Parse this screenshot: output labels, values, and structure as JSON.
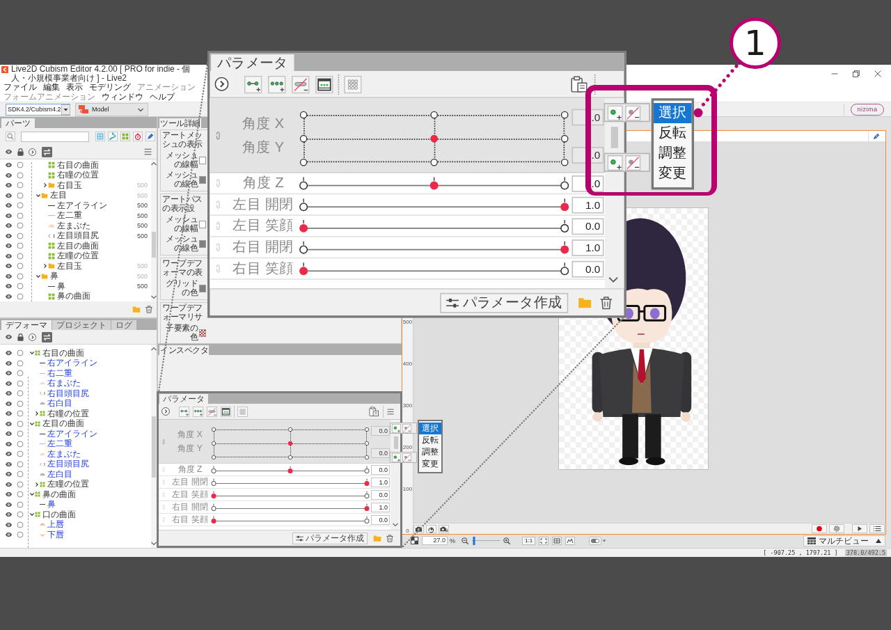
{
  "window": {
    "title": "Live2D Cubism Editor 4.2.00 [ PRO for indie - 個人・小規模事業者向け ] - Live2"
  },
  "menu": [
    {
      "label": "ファイル",
      "disabled": false
    },
    {
      "label": "編集",
      "disabled": false
    },
    {
      "label": "表示",
      "disabled": false
    },
    {
      "label": "モデリング",
      "disabled": false
    },
    {
      "label": "アニメーション",
      "disabled": true
    },
    {
      "label": "フォームアニメーション",
      "disabled": true
    },
    {
      "label": "ウィンドウ",
      "disabled": false
    },
    {
      "label": "ヘルプ",
      "disabled": false
    }
  ],
  "toolbar": {
    "sdk_select": "SDK4.2/Cubism4.2",
    "mode_dropdown": "Model",
    "logo": "nizima"
  },
  "parts_panel": {
    "tab": "パーツ",
    "tree": [
      {
        "children": [
          {
            "label": "右目の曲面",
            "kind": "warp"
          },
          {
            "label": "右瞳の位置",
            "kind": "warp"
          },
          {
            "label": "右目玉",
            "kind": "folder",
            "expanded": false,
            "value": "500"
          }
        ]
      },
      {
        "label": "左目",
        "kind": "folder",
        "expanded": true,
        "value": "500",
        "children": [
          {
            "label": "左アイライン",
            "kind": "line",
            "color": "#3d2f4f",
            "value": "500"
          },
          {
            "label": "左二重",
            "kind": "line",
            "color": "#e6a9a9",
            "value": "500"
          },
          {
            "label": "左まぶた",
            "kind": "lid",
            "color": "#fbd9c4",
            "value": "500"
          },
          {
            "label": "左目頭目尻",
            "kind": "corner",
            "value": "500"
          },
          {
            "label": "左目の曲面",
            "kind": "warp"
          },
          {
            "label": "左瞳の位置",
            "kind": "warp"
          },
          {
            "label": "左目玉",
            "kind": "folder",
            "expanded": false,
            "value": "500"
          }
        ]
      },
      {
        "label": "鼻",
        "kind": "folder",
        "expanded": true,
        "value": "500",
        "children": [
          {
            "label": "鼻",
            "kind": "line",
            "color": "#4a4a4a",
            "value": "500"
          },
          {
            "label": "鼻の曲面",
            "kind": "warp"
          }
        ]
      }
    ]
  },
  "deformer_panel": {
    "tabs": [
      {
        "label": "デフォーマ",
        "selected": true
      },
      {
        "label": "プロジェクト",
        "selected": false
      },
      {
        "label": "ログ",
        "selected": false
      }
    ],
    "tree": [
      {
        "label": "右目の曲面",
        "kind": "warp",
        "expanded": true,
        "children": [
          {
            "label": "右アイライン",
            "kind": "line",
            "color": "#3d2f4f"
          },
          {
            "label": "右二重",
            "kind": "line",
            "color": "#e6a9a9"
          },
          {
            "label": "右まぶた",
            "kind": "lid",
            "color": "#fbd9c4"
          },
          {
            "label": "右目頭目尻",
            "kind": "corner"
          },
          {
            "label": "右白目",
            "kind": "lid",
            "color": "#b5b5b5"
          },
          {
            "label": "右瞳の位置",
            "kind": "warp",
            "expanded": false
          }
        ]
      },
      {
        "label": "左目の曲面",
        "kind": "warp",
        "expanded": true,
        "children": [
          {
            "label": "左アイライン",
            "kind": "line",
            "color": "#3d2f4f"
          },
          {
            "label": "左二重",
            "kind": "line",
            "color": "#e6a9a9"
          },
          {
            "label": "左まぶた",
            "kind": "lid",
            "color": "#fbd9c4"
          },
          {
            "label": "左目頭目尻",
            "kind": "corner"
          },
          {
            "label": "左白目",
            "kind": "lid",
            "color": "#b5b5b5"
          },
          {
            "label": "左瞳の位置",
            "kind": "warp",
            "expanded": false
          }
        ]
      },
      {
        "label": "鼻の曲面",
        "kind": "warp",
        "expanded": true,
        "children": [
          {
            "label": "鼻",
            "kind": "line",
            "color": "#4a4a4a"
          }
        ]
      },
      {
        "label": "口の曲面",
        "kind": "warp",
        "expanded": true,
        "children": [
          {
            "label": "上唇",
            "kind": "arch",
            "color": "#e9a98a"
          },
          {
            "label": "下唇",
            "kind": "cup",
            "color": "#f2c49a"
          }
        ]
      }
    ]
  },
  "tool_details": {
    "tab": "ツール詳細",
    "groups": [
      {
        "title": "アートメッシュの表示",
        "rows": [
          {
            "label": "メッシュの線幅",
            "kind": "field"
          },
          {
            "label": "メッシュの線色",
            "kind": "swatch",
            "color": "#808080"
          }
        ]
      },
      {
        "title": "アートパスの表示設",
        "rows": [
          {
            "label": "メッシュの線幅",
            "kind": "field"
          },
          {
            "label": "メッシュの線色",
            "kind": "swatch",
            "color": "#808080"
          }
        ]
      },
      {
        "title": "ワープデフォーマの表",
        "rows": [
          {
            "label": "グリッドの色",
            "kind": "swatch",
            "color": "#808080"
          }
        ]
      },
      {
        "title": "ワープデフォーマリサ",
        "rows": [
          {
            "label": "子要素の色",
            "kind": "pattern",
            "color": "#d42a2a"
          }
        ]
      }
    ]
  },
  "inspector_panel": {
    "tab": "インスペクタ"
  },
  "parameter_panel": {
    "tab": "パラメータ",
    "combined": [
      {
        "label": "角度 X",
        "value": "0.0",
        "level": 0.5
      },
      {
        "label": "角度 Y",
        "value": "0.0",
        "level": 0.5
      }
    ],
    "params": [
      {
        "label": "角度 Z",
        "value": "0.0",
        "level": 0.5
      },
      {
        "label": "左目 開閉",
        "value": "1.0",
        "level": 1
      },
      {
        "label": "左目 笑顔",
        "value": "0.0",
        "level": 0
      },
      {
        "label": "右目 開閉",
        "value": "1.0",
        "level": 1
      },
      {
        "label": "右目 笑顔",
        "value": "0.0",
        "level": 0
      }
    ],
    "create_button": "パラメータ作成",
    "menu": [
      {
        "label": "選択",
        "selected": true
      },
      {
        "label": "反転",
        "selected": false
      },
      {
        "label": "調整",
        "selected": false
      },
      {
        "label": "変更",
        "selected": false
      }
    ]
  },
  "parameter_panel_zoom": {
    "tab": "パラメータ",
    "combined": [
      {
        "label": "角度 X",
        "value": ".0",
        "level": 0.5
      },
      {
        "label": "角度 Y",
        "value": ".0",
        "level": 0.5
      }
    ],
    "params": [
      {
        "label": "角度 Z",
        "value": ".0",
        "level": 0.5
      },
      {
        "label": "左目 開閉",
        "value": "1.0",
        "level": 1
      },
      {
        "label": "左目 笑顔",
        "value": "0.0",
        "level": 0
      },
      {
        "label": "右目 開閉",
        "value": "1.0",
        "level": 1
      },
      {
        "label": "右目 笑顔",
        "value": "0.0",
        "level": 0
      }
    ],
    "create_button": "パラメータ作成",
    "menu": [
      {
        "label": "選択",
        "selected": true
      },
      {
        "label": "反転",
        "selected": false
      },
      {
        "label": "調整",
        "selected": false
      },
      {
        "label": "変更",
        "selected": false
      }
    ]
  },
  "canvas": {
    "ruler": [
      "500",
      "400",
      "300",
      "200",
      "100",
      "0"
    ],
    "zoom_value": "27.0",
    "zoom_unit": "%",
    "zoom_slider": {
      "level": 0.07
    },
    "scale_button": "1:1",
    "view_button": "マルチビュー"
  },
  "status_bar": {
    "coordinates": "[ -907.25 , 1797.21 ]",
    "canvas_size": "378.0/492.5"
  },
  "callout": {
    "number": "1"
  }
}
